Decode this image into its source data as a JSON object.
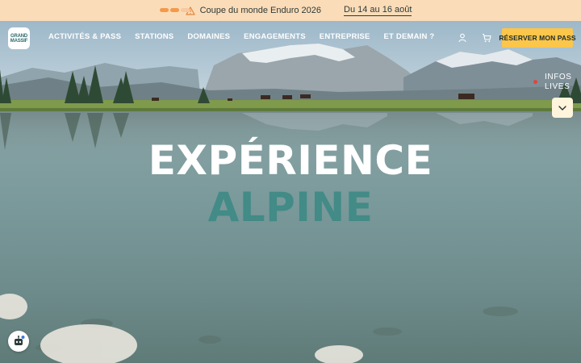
{
  "alert": {
    "message": "Coupe du monde Enduro 2026",
    "date_link": "Du 14 au 16 août",
    "icon": "warning-triangle-icon",
    "pager_count": 3,
    "pager_active": 2
  },
  "header": {
    "logo_line1": "GRAND",
    "logo_line2": "MASSIF",
    "nav": [
      "ACTIVITÉS & PASS",
      "STATIONS",
      "DOMAINES",
      "ENGAGEMENTS",
      "ENTREPRISE",
      "ET DEMAIN ?"
    ],
    "cta_label": "RÉSERVER MON PASS",
    "user_icon": "user-icon",
    "cart_icon": "cart-icon"
  },
  "infos": {
    "line1": "INFOS",
    "line2": "LIVES",
    "toggle_icon": "chevron-down-icon"
  },
  "hero": {
    "title_line1": "EXPÉRIENCE",
    "title_line2": "ALPINE"
  },
  "chat": {
    "icon": "chat-bot-icon"
  },
  "colors": {
    "alert_bg": "#fbdcb8",
    "cta_bg": "#fbc64a",
    "accent_teal": "#3e8a86",
    "live_dot": "#e2453c"
  }
}
